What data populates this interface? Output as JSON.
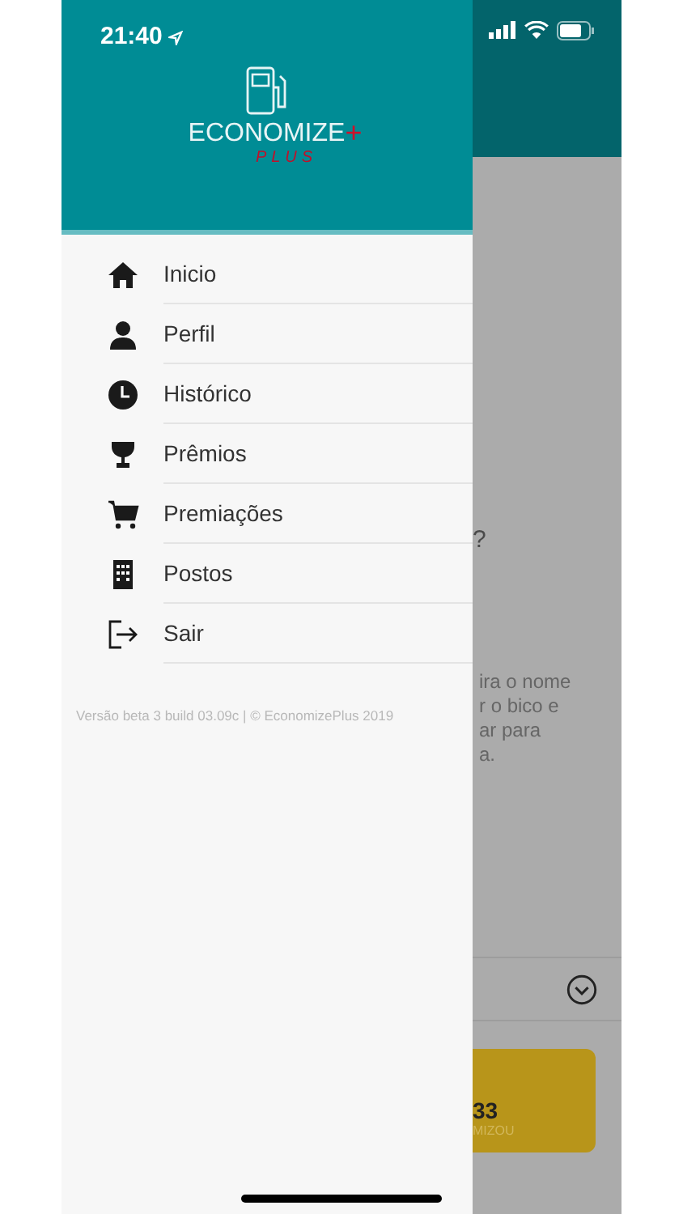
{
  "status_bar": {
    "time": "21:40"
  },
  "logo": {
    "wordmark": "ECONOMIZE",
    "plus_sign": "+",
    "subtitle": "PLUS"
  },
  "menu": [
    {
      "label": "Inicio",
      "kind": "home"
    },
    {
      "label": "Perfil",
      "kind": "person"
    },
    {
      "label": "Histórico",
      "kind": "clock"
    },
    {
      "label": "Prêmios",
      "kind": "trophy"
    },
    {
      "label": "Premiações",
      "kind": "cart"
    },
    {
      "label": "Postos",
      "kind": "building"
    },
    {
      "label": "Sair",
      "kind": "exit"
    }
  ],
  "footer": "Versão beta 3 build 03.09c | © EconomizePlus 2019",
  "background": {
    "question": "?",
    "paragraph_lines": [
      "ira o nome",
      "r o bico e",
      "ar para",
      "a."
    ],
    "card_value": "33",
    "card_caption": "MIZOU"
  }
}
